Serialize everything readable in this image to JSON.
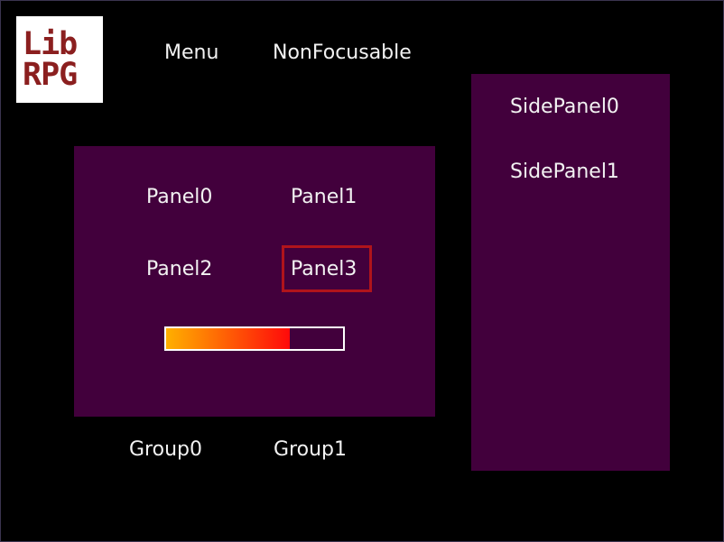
{
  "logo": {
    "line1": "Lib",
    "line2": "RPG"
  },
  "top_menu": {
    "menu_label": "Menu",
    "nonfocusable_label": "NonFocusable"
  },
  "main_panel": {
    "items": [
      "Panel0",
      "Panel1",
      "Panel2",
      "Panel3"
    ],
    "focused_item": "Panel3",
    "progress": 0.7,
    "colors": {
      "background": "#42003c",
      "focus_border": "#b0141b",
      "bar_start": "#ffb000",
      "bar_end": "#ff0a0a"
    }
  },
  "groups": [
    "Group0",
    "Group1"
  ],
  "side_panel": {
    "items": [
      "SidePanel0",
      "SidePanel1"
    ]
  }
}
